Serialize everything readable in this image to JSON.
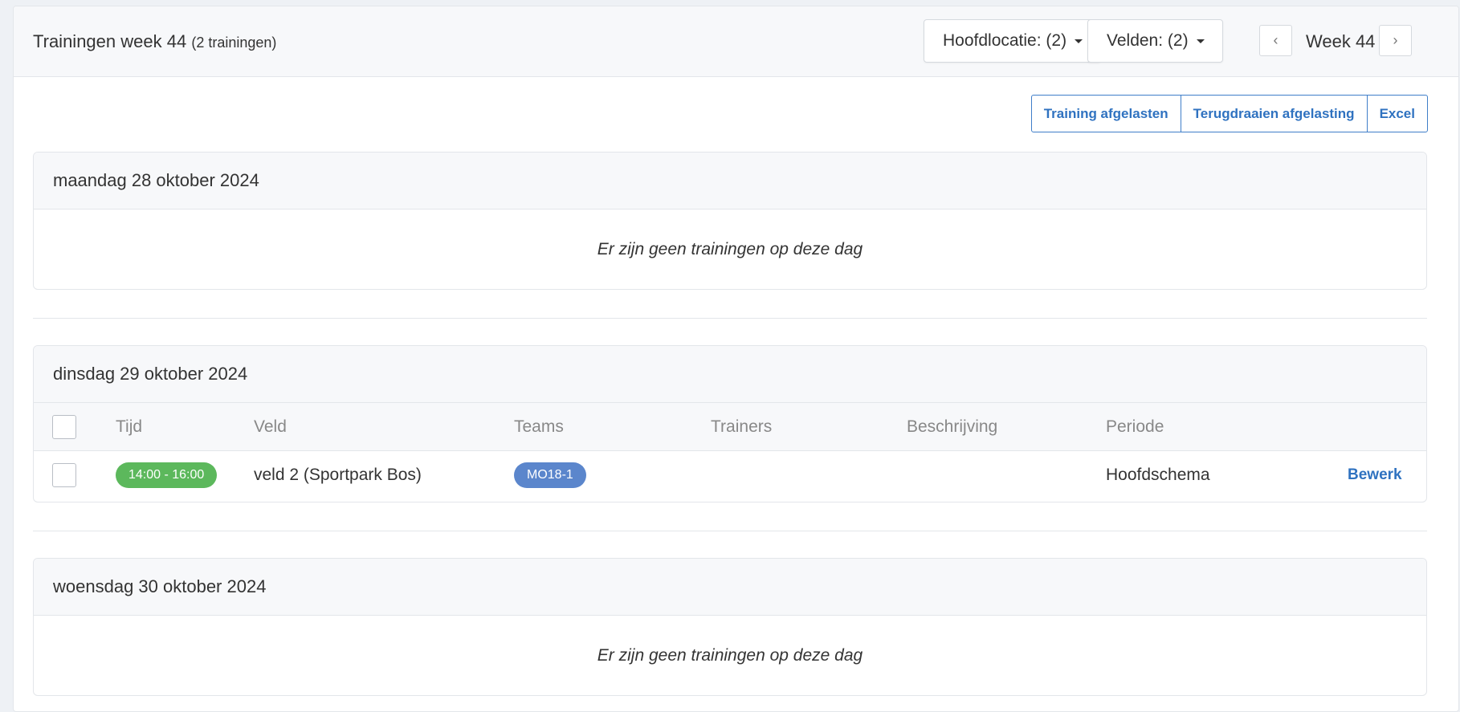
{
  "header": {
    "title": "Trainingen week 44",
    "count": "(2 trainingen)",
    "location_filter": "Hoofdlocatie: (2)",
    "fields_filter": "Velden: (2)",
    "prev_icon": "‹",
    "next_icon": "›",
    "week_label": "Week 44"
  },
  "actions": {
    "cancel_training": "Training afgelasten",
    "revert_cancellation": "Terugdraaien afgelasting",
    "excel": "Excel"
  },
  "table": {
    "columns": [
      "Tijd",
      "Veld",
      "Teams",
      "Trainers",
      "Beschrijving",
      "Periode"
    ]
  },
  "days": [
    {
      "title": "maandag 28 oktober 2024",
      "empty_message": "Er zijn geen trainingen op deze dag"
    },
    {
      "title": "dinsdag 29 oktober 2024",
      "rows": [
        {
          "time": "14:00 - 16:00",
          "field": "veld 2 (Sportpark Bos)",
          "team": "MO18-1",
          "trainers": "",
          "description": "",
          "period": "Hoofdschema",
          "edit_label": "Bewerk"
        }
      ]
    },
    {
      "title": "woensdag 30 oktober 2024",
      "empty_message": "Er zijn geen trainingen op deze dag"
    }
  ],
  "colors": {
    "accent": "#2f72c0",
    "time_badge": "#5cb85c",
    "team_badge": "#5b86cc"
  }
}
